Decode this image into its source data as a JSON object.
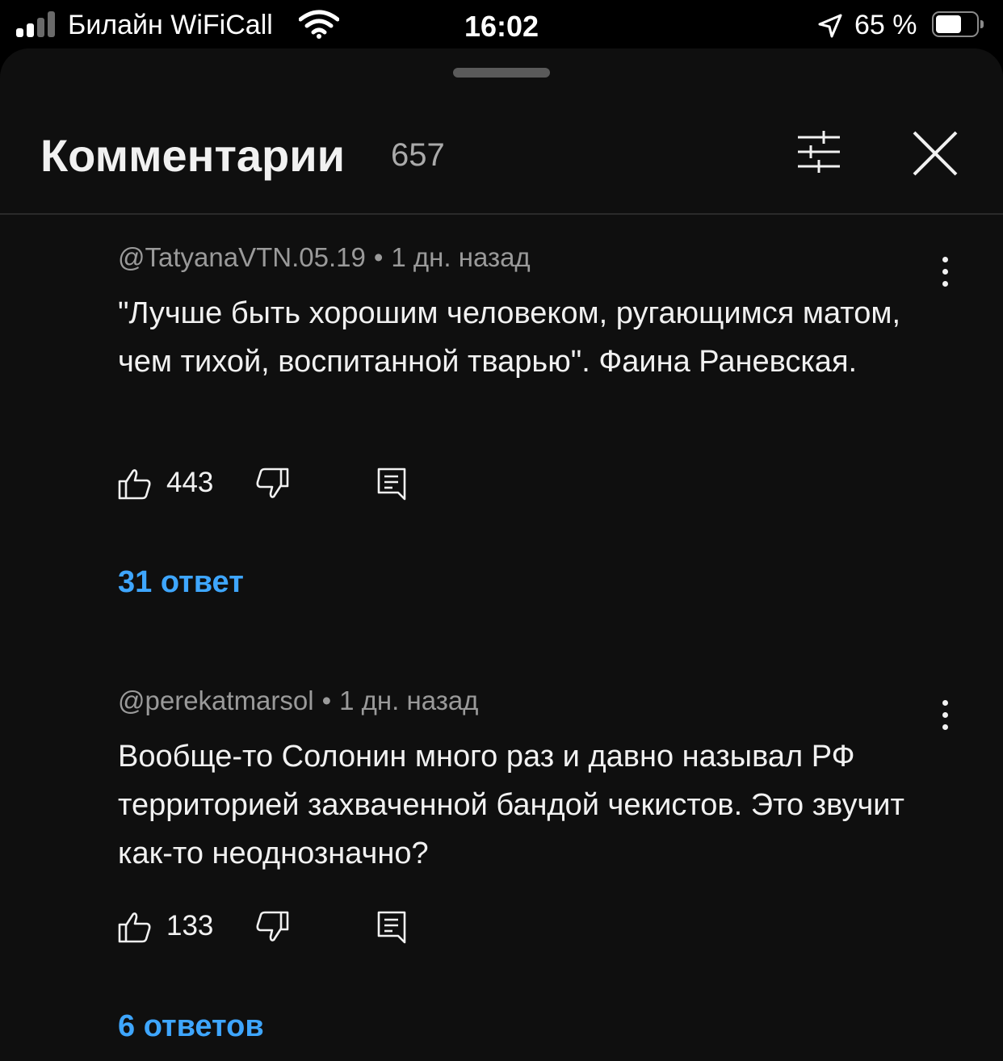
{
  "status_bar": {
    "carrier": "Билайн WiFiCall",
    "time": "16:02",
    "battery_percent": "65 %",
    "battery_level": 0.65
  },
  "header": {
    "title": "Комментарии",
    "count": "657",
    "filter_icon": "sliders-icon",
    "close_icon": "close-icon"
  },
  "comments": [
    {
      "author": "@TatyanaVTN.05.19",
      "separator": "•",
      "time": "1 дн. назад",
      "text": "\"Лучше быть хорошим человеком, ругающимся матом, чем тихой, воспитанной тварью\". Фаина Раневская.",
      "likes": "443",
      "replies": "31 ответ"
    },
    {
      "author": "@perekatmarsol",
      "separator": "•",
      "time": "1 дн. назад",
      "text": "Вообще-то Солонин много раз и давно называл РФ территорией захваченной бандой чекистов. Это звучит как-то  неоднозначно?",
      "likes": "133",
      "replies": "6 ответов"
    }
  ],
  "colors": {
    "background": "#0f0f0f",
    "text": "#f1f1f1",
    "secondary_text": "#aaaaaa",
    "link": "#3ea6ff"
  }
}
